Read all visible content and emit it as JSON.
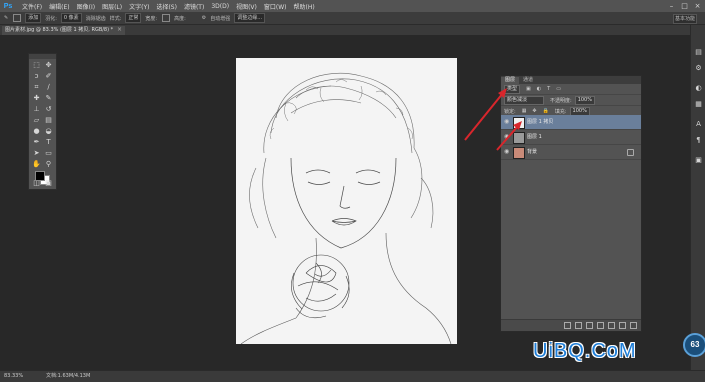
{
  "app": {
    "logo": "Ps"
  },
  "menu": [
    "文件(F)",
    "编辑(E)",
    "图像(I)",
    "图层(L)",
    "文字(Y)",
    "选择(S)",
    "滤镜(T)",
    "3D(D)",
    "视图(V)",
    "窗口(W)",
    "帮助(H)"
  ],
  "window_controls": {
    "minimize": "–",
    "maximize": "□",
    "close": "×"
  },
  "options": {
    "mode_value": "添加",
    "feather_label": "羽化:",
    "feather_value": "0 像素",
    "smooth_label": "消除锯齿",
    "style_label": "样式:",
    "style_value": "正常",
    "width_label": "宽度:",
    "height_label": "高度:",
    "auto_enhance_label": "自动增强",
    "refine_edge_label": "调整边缘..."
  },
  "workspace": {
    "label": "基本功能"
  },
  "document": {
    "tab_title": "图片素材.jpg @ 83.3% (图层 1 拷贝, RGB/8) *",
    "close_glyph": "×"
  },
  "layers_panel": {
    "tabs": [
      "图层",
      "通道"
    ],
    "filter_value": "类型",
    "blend_mode": "颜色减淡",
    "opacity_label": "不透明度:",
    "opacity_value": "100%",
    "lock_label": "锁定:",
    "fill_label": "填充:",
    "fill_value": "100%",
    "layers": [
      {
        "name": "图层 1 拷贝",
        "selected": true
      },
      {
        "name": "图层 1",
        "selected": false
      },
      {
        "name": "背景",
        "selected": false
      }
    ]
  },
  "status_bar": {
    "zoom": "83.33%",
    "doc_info": "文档:1.63M/4.13M"
  },
  "efficiency": {
    "value": "63"
  },
  "watermark": {
    "text": "UiBQ.CoM"
  },
  "colors": {
    "accent": "#31a8ff",
    "annotation_arrow": "#d9262c",
    "selected_layer": "#6a7f9b",
    "watermark": "#1e7ed8"
  }
}
